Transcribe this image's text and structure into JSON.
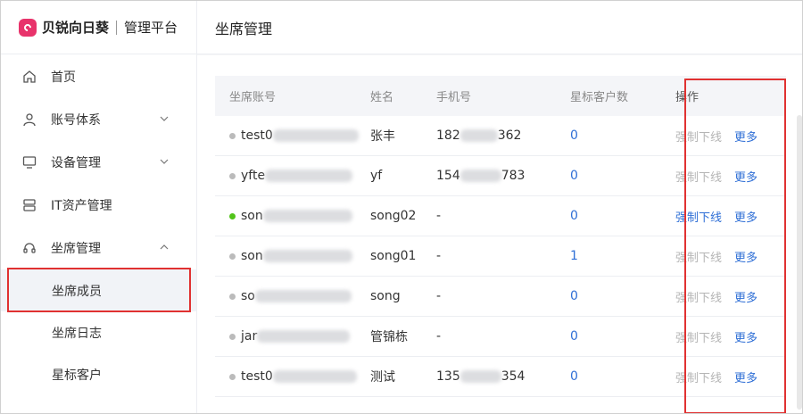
{
  "brand": {
    "name": "贝锐向日葵",
    "sub": "管理平台"
  },
  "nav": {
    "home": "首页",
    "accounts": "账号体系",
    "devices": "设备管理",
    "it_assets": "IT资产管理",
    "seats": "坐席管理",
    "seat_members": "坐席成员",
    "seat_logs": "坐席日志",
    "starred": "星标客户"
  },
  "page_title": "坐席管理",
  "table": {
    "headers": [
      "坐席账号",
      "姓名",
      "手机号",
      "星标客户数",
      "操作"
    ],
    "rows": [
      {
        "account": "test0",
        "name": "张丰",
        "phone_pre": "182",
        "phone_suf": "362",
        "stars": "0",
        "online": false
      },
      {
        "account": "yfte",
        "name": "yf",
        "phone_pre": "154",
        "phone_suf": "783",
        "stars": "0",
        "online": false
      },
      {
        "account": "son",
        "name": "song02",
        "phone_pre": "-",
        "phone_suf": "",
        "stars": "0",
        "online": true
      },
      {
        "account": "son",
        "name": "song01",
        "phone_pre": "-",
        "phone_suf": "",
        "stars": "1",
        "online": false
      },
      {
        "account": "so",
        "name": "song",
        "phone_pre": "-",
        "phone_suf": "",
        "stars": "0",
        "online": false
      },
      {
        "account": "jar",
        "name": "管锦栋",
        "phone_pre": "-",
        "phone_suf": "",
        "stars": "0",
        "online": false
      },
      {
        "account": "test0",
        "name": "测试",
        "phone_pre": "135",
        "phone_suf": "354",
        "stars": "0",
        "online": false
      }
    ],
    "op_force": "强制下线",
    "op_more": "更多"
  },
  "colors": {
    "brand": "#e8336b",
    "link": "#2f6fd6",
    "online": "#52c41a",
    "highlight": "#e03131"
  }
}
